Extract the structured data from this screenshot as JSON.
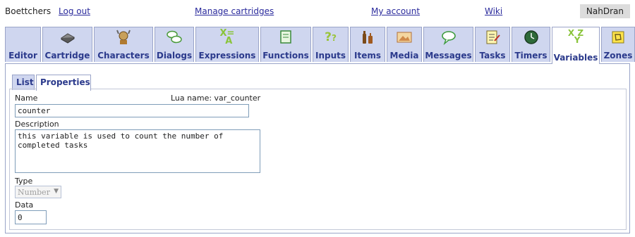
{
  "header": {
    "username": "Boettchers",
    "logout": "Log out",
    "manage_cartridges": "Manage cartridges",
    "my_account": "My account",
    "wiki": "Wiki",
    "badge": "NahDran"
  },
  "tabs": [
    {
      "label": "Editor",
      "icon": "editor-icon"
    },
    {
      "label": "Cartridge",
      "icon": "cartridge-icon"
    },
    {
      "label": "Characters",
      "icon": "characters-icon"
    },
    {
      "label": "Dialogs",
      "icon": "dialogs-icon"
    },
    {
      "label": "Expressions",
      "icon": "expressions-icon"
    },
    {
      "label": "Functions",
      "icon": "functions-icon"
    },
    {
      "label": "Inputs",
      "icon": "inputs-icon"
    },
    {
      "label": "Items",
      "icon": "items-icon"
    },
    {
      "label": "Media",
      "icon": "media-icon"
    },
    {
      "label": "Messages",
      "icon": "messages-icon"
    },
    {
      "label": "Tasks",
      "icon": "tasks-icon"
    },
    {
      "label": "Timers",
      "icon": "timers-icon"
    },
    {
      "label": "Variables",
      "icon": "variables-icon",
      "active": true
    },
    {
      "label": "Zones",
      "icon": "zones-icon"
    }
  ],
  "subtabs": [
    {
      "label": "List"
    },
    {
      "label": "Properties",
      "active": true
    }
  ],
  "form": {
    "name_label": "Name",
    "lua_name": "Lua name: var_counter",
    "name_value": "counter",
    "description_label": "Description",
    "description_value": "this variable is used to count the number of\ncompleted tasks",
    "type_label": "Type",
    "type_value": "Number",
    "data_label": "Data",
    "data_value": "0"
  },
  "colors": {
    "tab_bg": "#cfd6ef",
    "tab_label": "#2b3a8c",
    "link": "#2a2a9c",
    "border": "#9aa4c8"
  }
}
